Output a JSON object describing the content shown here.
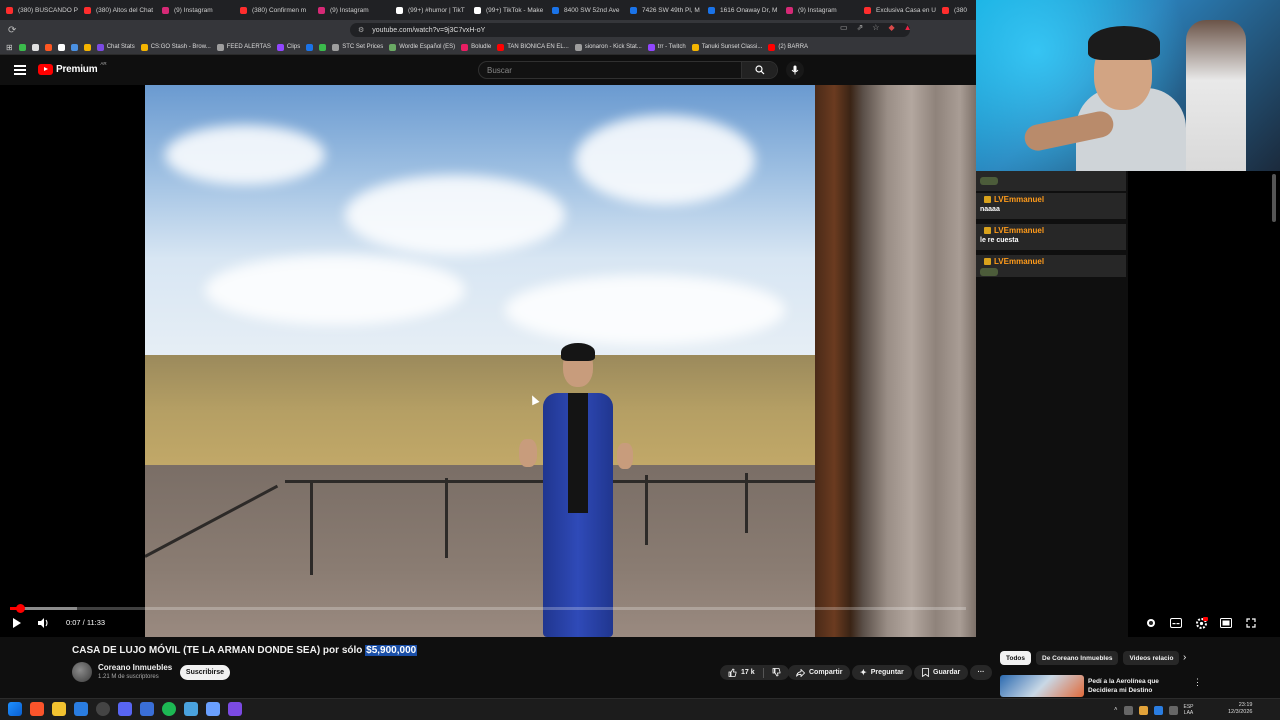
{
  "browser": {
    "tabs": [
      {
        "label": "(380) BUSCANDO P",
        "color": "#ff2d2d"
      },
      {
        "label": "(380) Altos del Chat",
        "color": "#ff2d2d"
      },
      {
        "label": "(9) Instagram",
        "color": "#d62976"
      },
      {
        "label": "(380) Confirmen m",
        "color": "#ff2d2d"
      },
      {
        "label": "(9) Instagram",
        "color": "#d62976"
      },
      {
        "label": "(99+) #humor | TikT",
        "color": "#ffffff"
      },
      {
        "label": "(99+) TikTok - Make",
        "color": "#ffffff"
      },
      {
        "label": "8400 SW 52nd Ave",
        "color": "#1a73e8"
      },
      {
        "label": "7426 SW 49th Pl, M",
        "color": "#1a73e8"
      },
      {
        "label": "1616 Onaway Dr, M",
        "color": "#1a73e8"
      },
      {
        "label": "(9) Instagram",
        "color": "#d62976"
      },
      {
        "label": "Exclusiva Casa en U",
        "color": "#ff2d2d"
      },
      {
        "label": "(380",
        "color": "#ff2d2d"
      }
    ],
    "url": "youtube.com/watch?v=9j3C7vxH-oY",
    "bookmarks": [
      {
        "label": "",
        "color": "#3bbb4c"
      },
      {
        "label": "",
        "color": "#e0e0e0"
      },
      {
        "label": "",
        "color": "#ff5722"
      },
      {
        "label": "",
        "color": "#ffffff"
      },
      {
        "label": "",
        "color": "#4a90e2"
      },
      {
        "label": "",
        "color": "#f4b400"
      },
      {
        "label": "Chat Stats",
        "color": "#7b4ae2"
      },
      {
        "label": "CS:GO Stash - Brow...",
        "color": "#f4b400"
      },
      {
        "label": "FEED ALERTAS",
        "color": "#9e9e9e"
      },
      {
        "label": "Clips",
        "color": "#9146ff"
      },
      {
        "label": "",
        "color": "#1a73e8"
      },
      {
        "label": "",
        "color": "#3bbb4c"
      },
      {
        "label": "STC Set Prices",
        "color": "#9e9e9e"
      },
      {
        "label": "Wordle Español (ES)",
        "color": "#6aaa64"
      },
      {
        "label": "Boludle",
        "color": "#e91e63"
      },
      {
        "label": "TAN BIONICA EN EL...",
        "color": "#ff0000"
      },
      {
        "label": "sionaron - Kick Stat...",
        "color": "#9e9e9e"
      },
      {
        "label": "trr - Twitch",
        "color": "#9146ff"
      },
      {
        "label": "Tanuki Sunset Classi...",
        "color": "#f4b400"
      },
      {
        "label": "(2) BARRA",
        "color": "#ff0000"
      }
    ]
  },
  "youtube": {
    "logo_text": "Premium",
    "logo_country": "AR",
    "search_placeholder": "Buscar",
    "player": {
      "time": "0:07 / 11:33",
      "progress_fraction": 0.0101,
      "buffered_fraction": 0.07
    },
    "video": {
      "title_before": "CASA DE LUJO MÓVIL (TE LA ARMAN DONDE SEA) por sólo ",
      "title_highlight": "$5,900,000",
      "channel_name": "Coreano Inmuebles",
      "channel_subs": "1.21 M de suscriptores",
      "subscribe_label": "Suscribirse",
      "like_count": "17 k",
      "share_label": "Compartir",
      "ask_label": "Preguntar",
      "save_label": "Guardar"
    },
    "chips": [
      {
        "label": "Todos",
        "active": true
      },
      {
        "label": "De Coreano Inmuebles",
        "active": false
      },
      {
        "label": "Videos relacio",
        "active": false
      }
    ],
    "recommendation": {
      "title": "Pedí a la Aerolínea que Decidiera mi Destino"
    }
  },
  "stream_chat": {
    "messages": [
      {
        "user": "",
        "text": "",
        "emote": true
      },
      {
        "user": "LVEmmanuel",
        "text": "naaaa"
      },
      {
        "user": "LVEmmanuel",
        "text": "le re cuesta"
      },
      {
        "user": "LVEmmanuel",
        "text": "",
        "emote": true
      }
    ]
  },
  "taskbar": {
    "language": "ESP\nLAA",
    "time": "23:19",
    "date": "12/3/2026"
  }
}
